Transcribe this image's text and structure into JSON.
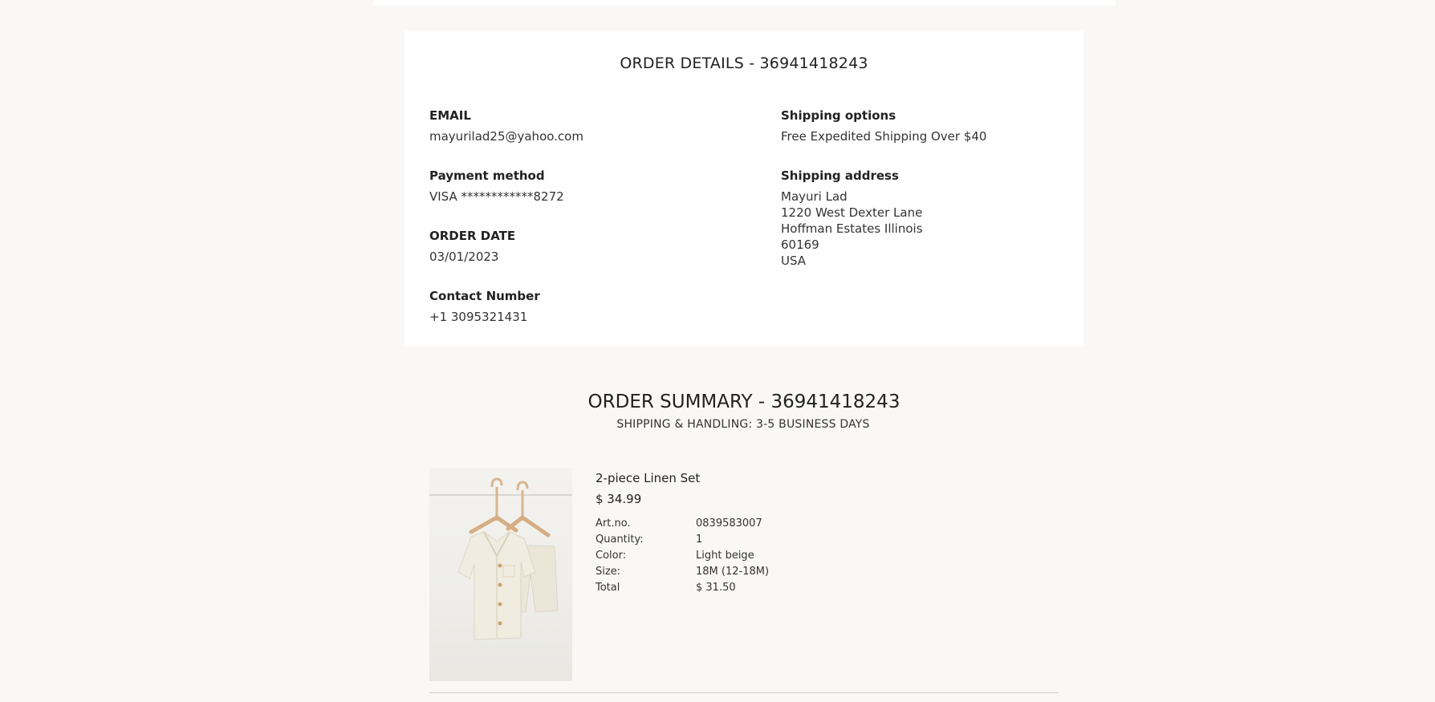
{
  "order_details": {
    "title": "ORDER DETAILS - 36941418243",
    "email_label": "EMAIL",
    "email_value": "mayurilad25@yahoo.com",
    "payment_label": "Payment method",
    "payment_value": "VISA ************8272",
    "order_date_label": "ORDER DATE",
    "order_date_value": "03/01/2023",
    "contact_label": "Contact Number",
    "contact_value": "+1 3095321431",
    "shipping_options_label": "Shipping options",
    "shipping_options_value": "Free Expedited Shipping Over $40",
    "shipping_address_label": "Shipping address",
    "shipping_address_lines": [
      "Mayuri Lad",
      "1220 West Dexter Lane",
      "Hoffman Estates Illinois",
      "60169",
      "USA"
    ]
  },
  "order_summary": {
    "title": "ORDER SUMMARY - 36941418243",
    "subtitle": "SHIPPING & HANDLING:  3-5 BUSINESS DAYS",
    "product": {
      "name": "2-piece Linen Set",
      "price": "$ 34.99",
      "specs": [
        {
          "key": "Art.no.",
          "value": "0839583007"
        },
        {
          "key": "Quantity:",
          "value": "1"
        },
        {
          "key": "Color:",
          "value": "Light beige"
        },
        {
          "key": "Size:",
          "value": "18M (12-18M)"
        },
        {
          "key": "Total",
          "value": "$ 31.50"
        }
      ]
    }
  }
}
